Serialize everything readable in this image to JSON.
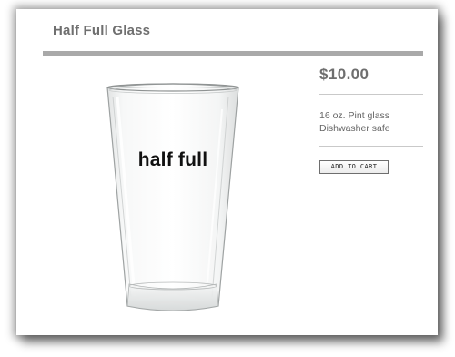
{
  "product": {
    "title": "Half Full Glass",
    "glass_print": "half full",
    "price": "$10.00",
    "details": [
      "16 oz. Pint glass",
      "Dishwasher safe"
    ],
    "add_to_cart_label": "ADD TO CART"
  },
  "colors": {
    "title_gray": "#6f6f6f",
    "header_rule": "#a9a9a9",
    "divider": "#c9c9c9"
  },
  "icons": {
    "product_image": "pint-glass"
  }
}
